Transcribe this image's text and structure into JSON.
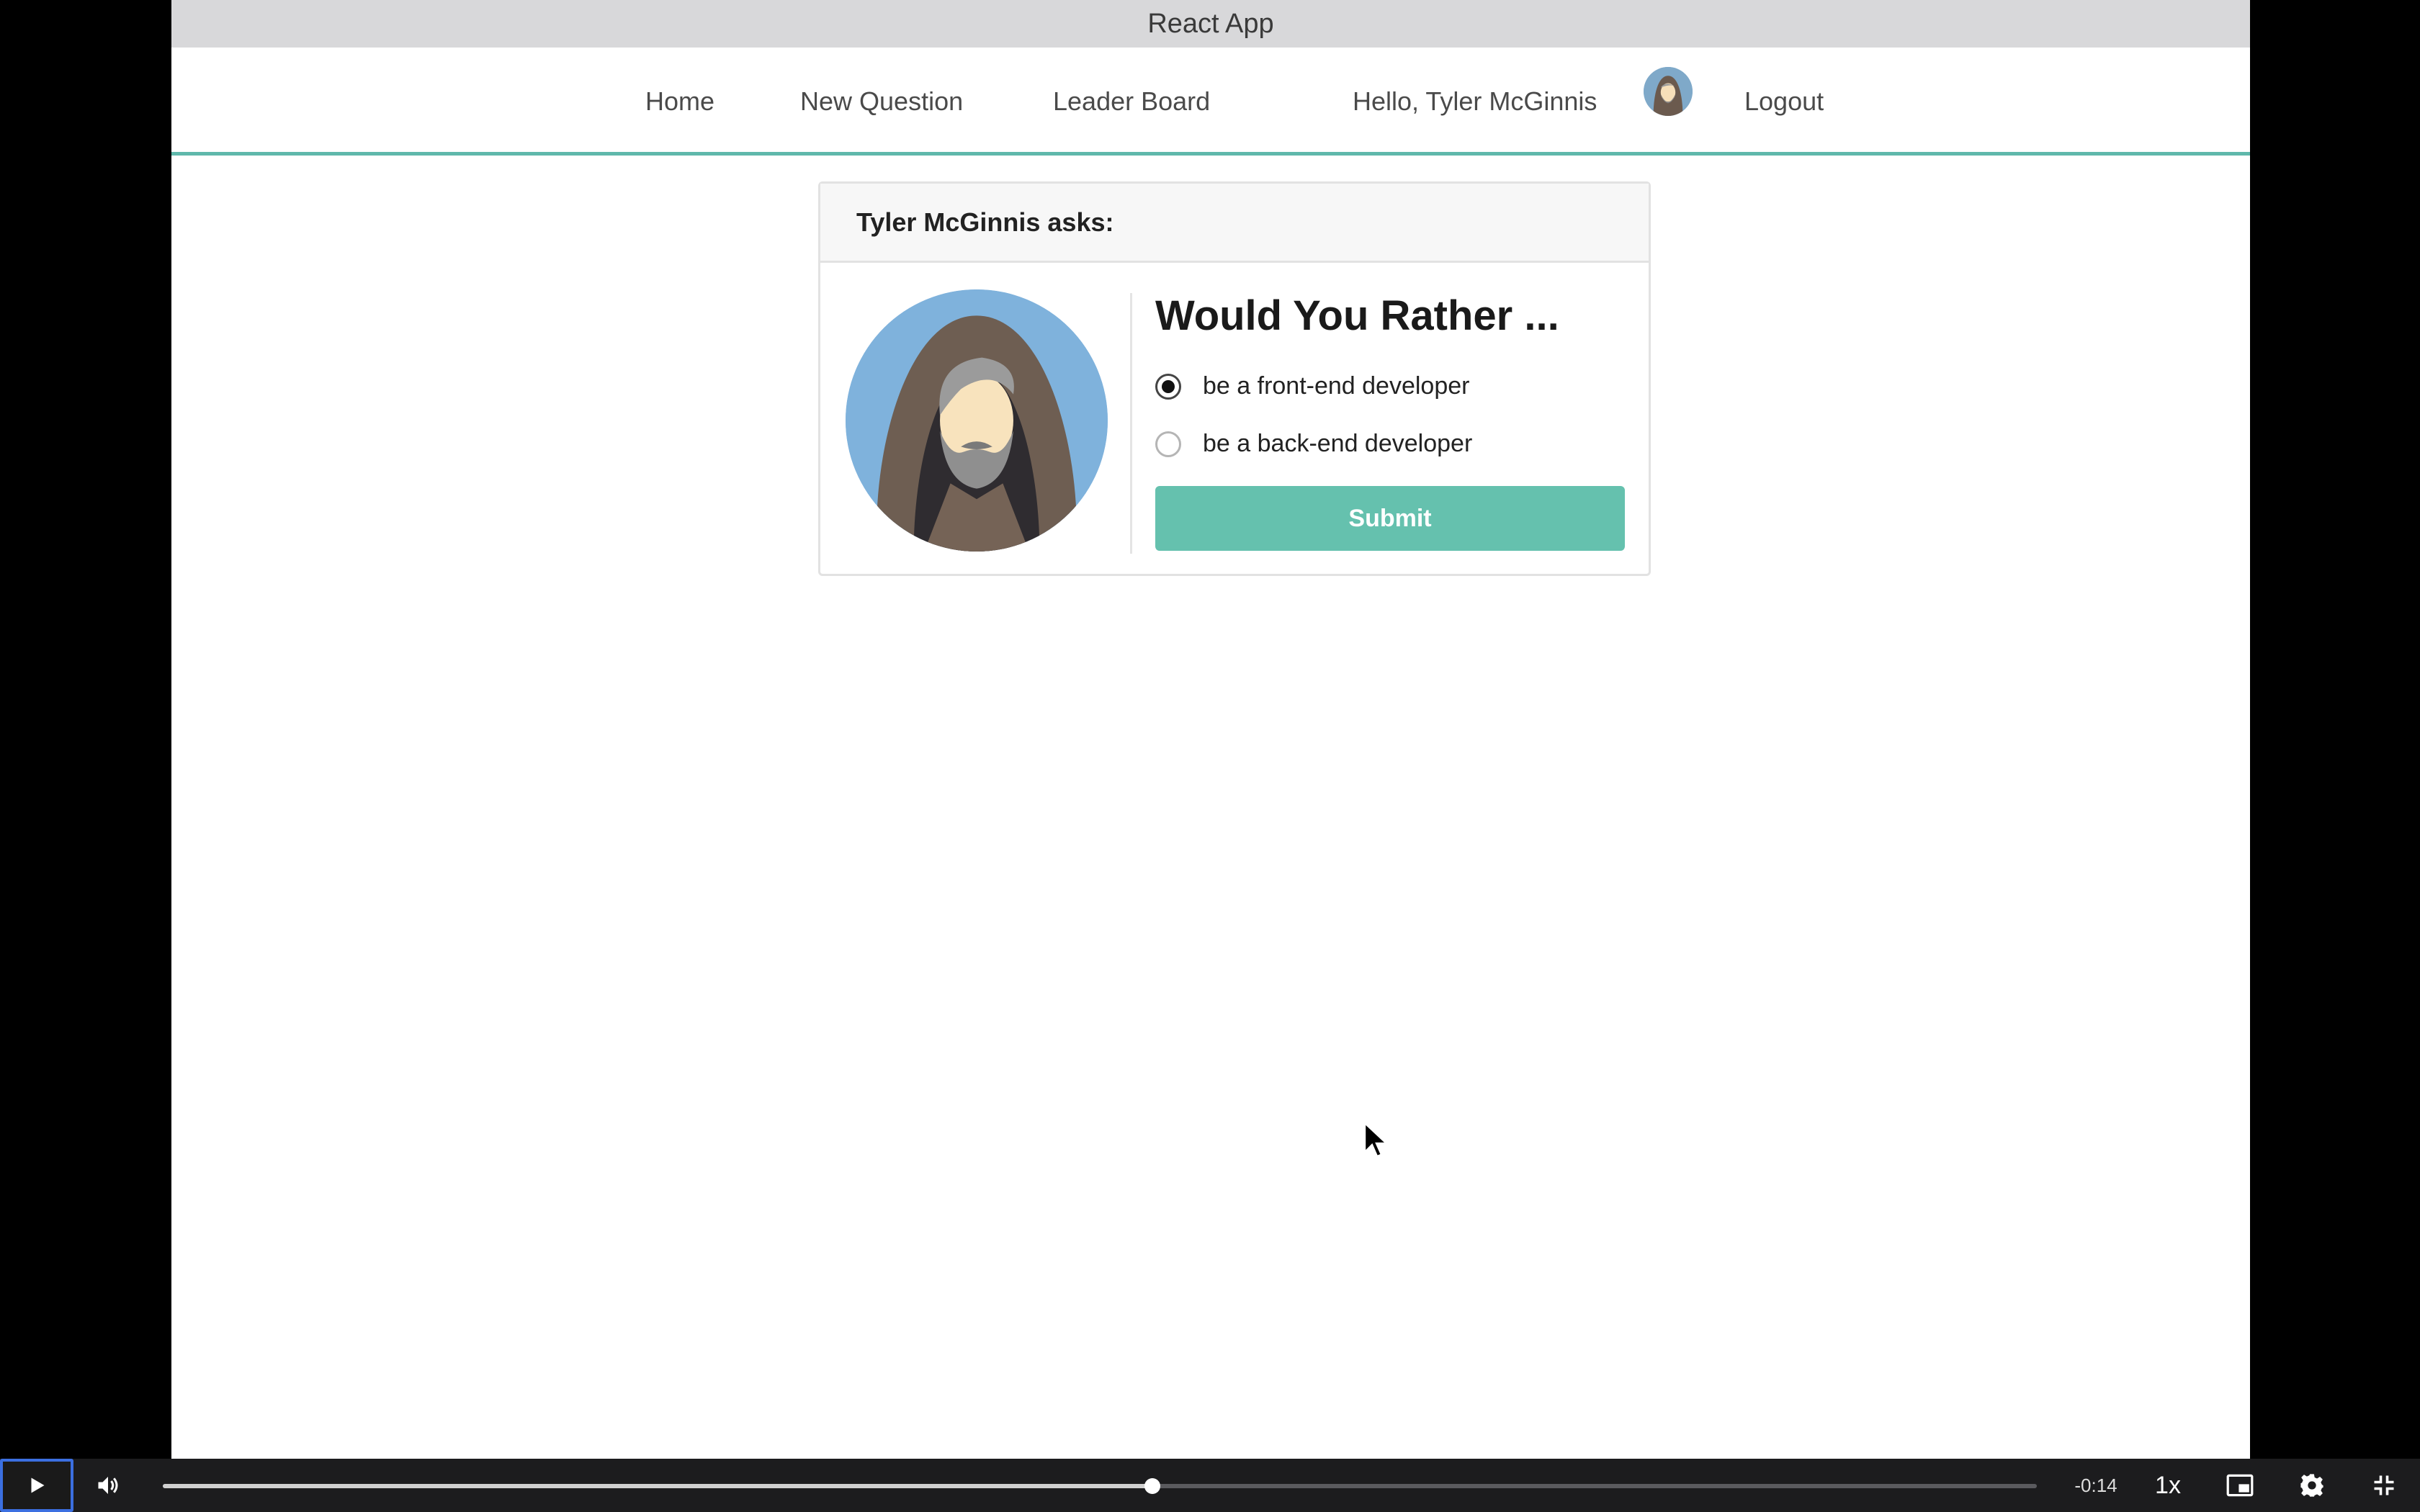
{
  "window": {
    "title": "React App"
  },
  "nav": {
    "home": "Home",
    "new_question": "New Question",
    "leader_board": "Leader Board",
    "greeting": "Hello, Tyler McGinnis",
    "logout": "Logout"
  },
  "question": {
    "author_header": "Tyler McGinnis asks:",
    "title": "Would You Rather ...",
    "options": [
      {
        "label": "be a front-end developer",
        "selected": true
      },
      {
        "label": "be a back-end developer",
        "selected": false
      }
    ],
    "submit_label": "Submit"
  },
  "video_controls": {
    "time_remaining": "-0:14",
    "playback_speed": "1x",
    "progress_fraction": 0.528
  },
  "colors": {
    "accent": "#65c1ae",
    "nav_underline": "#5fb8ab",
    "avatar_background": "#7fb2dc"
  },
  "icons": {
    "play": "play-icon",
    "volume": "volume-icon",
    "pip": "picture-in-picture-icon",
    "settings": "gear-icon",
    "fullscreen": "exit-fullscreen-icon"
  }
}
